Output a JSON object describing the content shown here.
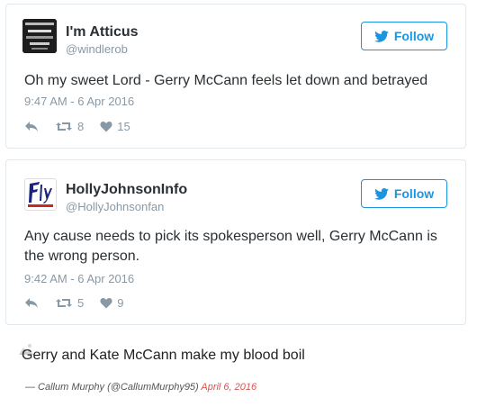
{
  "tweets": [
    {
      "name": "I'm Atticus",
      "handle": "@windlerob",
      "follow_label": "Follow",
      "text": "Oh my sweet Lord - Gerry McCann feels let down and betrayed",
      "timestamp": "9:47 AM - 6 Apr 2016",
      "retweets": "8",
      "likes": "15"
    },
    {
      "name": "HollyJohnsonInfo",
      "handle": "@HollyJohnsonfan",
      "follow_label": "Follow",
      "text": "Any cause needs to pick its spokesperson well, Gerry McCann is the wrong person.",
      "timestamp": "9:42 AM - 6 Apr 2016",
      "retweets": "5",
      "likes": "9"
    }
  ],
  "quote": {
    "text": "Gerry and Kate McCann make my blood boil",
    "attribution": "— Callum Murphy (@CallumMurphy95)",
    "date": "April 6, 2016"
  },
  "colors": {
    "twitter_blue": "#1b95e0",
    "muted": "#8899a6",
    "date_red": "#d9534f"
  }
}
